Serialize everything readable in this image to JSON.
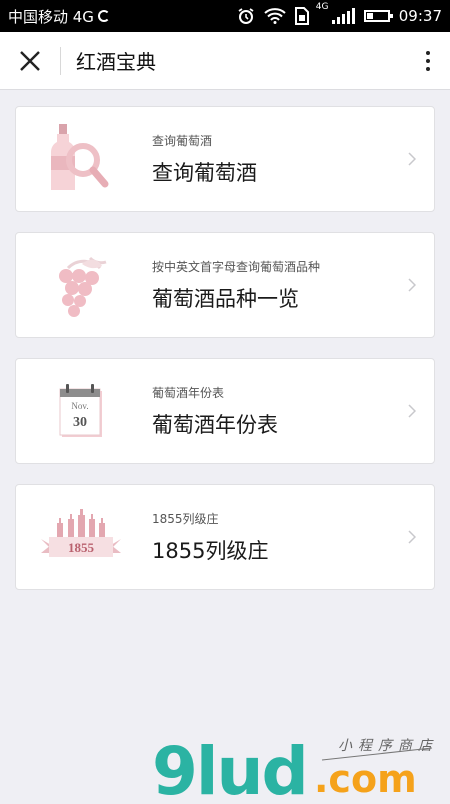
{
  "status_bar": {
    "carrier": "中国移动 4G",
    "network_label": "4G",
    "time": "09:37"
  },
  "nav": {
    "title": "红酒宝典",
    "close_icon": "close-icon",
    "more_icon": "more-vertical-icon"
  },
  "cards": [
    {
      "subtitle": "查询葡萄酒",
      "title": "查询葡萄酒",
      "icon": "wine-search-icon"
    },
    {
      "subtitle": "按中英文首字母查询葡萄酒品种",
      "title": "葡萄酒品种一览",
      "icon": "grape-icon"
    },
    {
      "subtitle": "葡萄酒年份表",
      "title": "葡萄酒年份表",
      "icon": "calendar-icon",
      "calendar_month": "Nov.",
      "calendar_day": "30"
    },
    {
      "subtitle": "1855列级庄",
      "title": "1855列级庄",
      "icon": "bottles-banner-icon",
      "banner_text": "1855"
    }
  ],
  "watermark": {
    "brand": "9lud",
    "domain": ".com",
    "slogan": "小程序商店"
  },
  "colors": {
    "accent_pink": "#f2c5cb",
    "background": "#efeff4",
    "watermark_teal": "#2bb3a3",
    "watermark_orange": "#f5a21b"
  }
}
